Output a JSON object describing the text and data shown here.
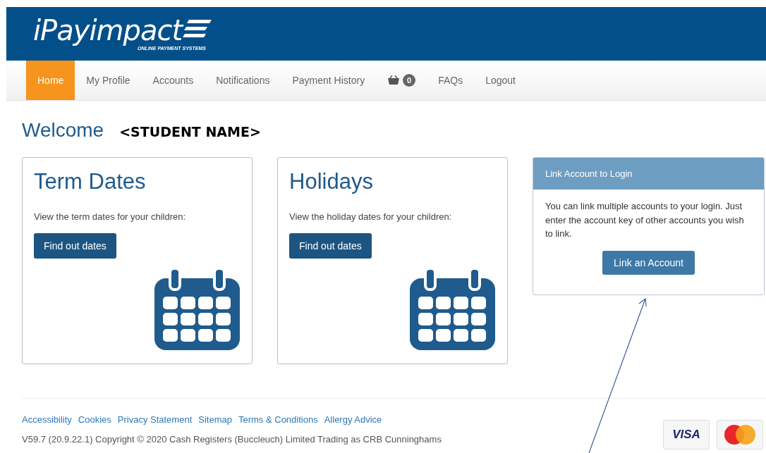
{
  "logo": {
    "name": "iPayimpact",
    "tagline": "ONLINE PAYMENT SYSTEMS"
  },
  "nav": [
    {
      "kind": "link",
      "label": "Home",
      "selected": true
    },
    {
      "kind": "link",
      "label": "My Profile",
      "selected": false
    },
    {
      "kind": "link",
      "label": "Accounts",
      "selected": false
    },
    {
      "kind": "link",
      "label": "Notifications",
      "selected": false
    },
    {
      "kind": "link",
      "label": "Payment History",
      "selected": false
    },
    {
      "kind": "basket",
      "label": "0",
      "selected": false
    },
    {
      "kind": "link",
      "label": "FAQs",
      "selected": false
    },
    {
      "kind": "link",
      "label": "Logout",
      "selected": false
    }
  ],
  "welcome": {
    "title": "Welcome",
    "name": "<STUDENT NAME>"
  },
  "cards": [
    {
      "title": "Term Dates",
      "text": "View the term dates for your children:",
      "button": "Find out dates"
    },
    {
      "title": "Holidays",
      "text": "View the holiday dates for your children:",
      "button": "Find out dates"
    }
  ],
  "link_panel": {
    "heading": "Link Account to Login",
    "text": "You can link multiple accounts to your login. Just enter the account key of other accounts you wish to link.",
    "button": "Link an Account"
  },
  "footer": {
    "links": [
      "Accessibility",
      "Cookies",
      "Privacy Statement",
      "Sitemap",
      "Terms & Conditions",
      "Allergy Advice"
    ],
    "copyright": "V59.7 (20.9.22.1) Copyright © 2020 Cash Registers (Buccleuch) Limited Trading as CRB Cunninghams",
    "card_logos": [
      {
        "kind": "visa",
        "label": "VISA"
      },
      {
        "kind": "mastercard"
      }
    ]
  }
}
